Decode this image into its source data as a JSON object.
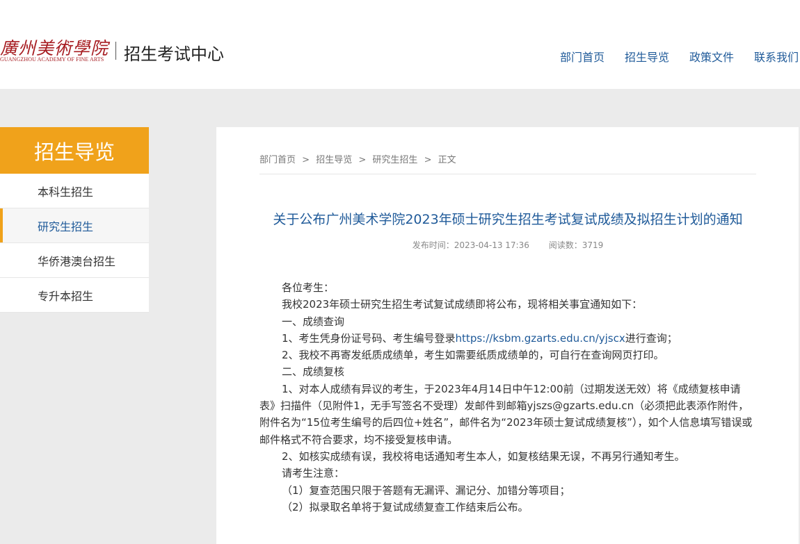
{
  "header": {
    "logo_cn": "廣州美術學院",
    "logo_en": "GUANGZHOU ACADEMY OF FINE ARTS",
    "site_title": "招生考试中心",
    "nav": [
      "部门首页",
      "招生导览",
      "政策文件",
      "联系我们"
    ]
  },
  "sidebar": {
    "title": "招生导览",
    "items": [
      {
        "label": "本科生招生",
        "active": false
      },
      {
        "label": "研究生招生",
        "active": true
      },
      {
        "label": "华侨港澳台招生",
        "active": false
      },
      {
        "label": "专升本招生",
        "active": false
      }
    ]
  },
  "breadcrumb": {
    "home": "部门首页",
    "section": "招生导览",
    "category": "研究生招生",
    "current": "正文",
    "sep": ">"
  },
  "article": {
    "title": "关于公布广州美术学院2023年硕士研究生招生考试复试成绩及拟招生计划的通知",
    "publish_time": "发布时间：2023-04-13 17:36",
    "views": "阅读数：3719",
    "p1": "各位考生：",
    "p2": "我校2023年硕士研究生招生考试复试成绩即将公布，现将相关事宜通知如下：",
    "p3": "一、成绩查询",
    "p4_pre": "1、考生凭身份证号码、考生编号登录",
    "p4_link": "https://ksbm.gzarts.edu.cn/yjscx",
    "p4_post": "进行查询；",
    "p5": "2、我校不再寄发纸质成绩单，考生如需要纸质成绩单的，可自行在查询网页打印。",
    "p6": "二、成绩复核",
    "p7": "1、对本人成绩有异议的考生，于2023年4月14日中午12:00前（过期发送无效）将《成绩复核申请表》扫描件（见附件1，无手写签名不受理）发邮件到邮箱yjszs@gzarts.edu.cn（必须把此表添作附件，附件名为“15位考生编号的后四位+姓名”，邮件名为“2023年硕士复试成绩复核”），如个人信息填写错误或邮件格式不符合要求，均不接受复核申请。",
    "p8": "2、如核实成绩有误，我校将电话通知考生本人，如复核结果无误，不再另行通知考生。",
    "p9": "请考生注意：",
    "p10": "（1）复查范围只限于答题有无漏评、漏记分、加错分等项目；",
    "p11": "（2）拟录取名单将于复试成绩复查工作结束后公布。"
  }
}
